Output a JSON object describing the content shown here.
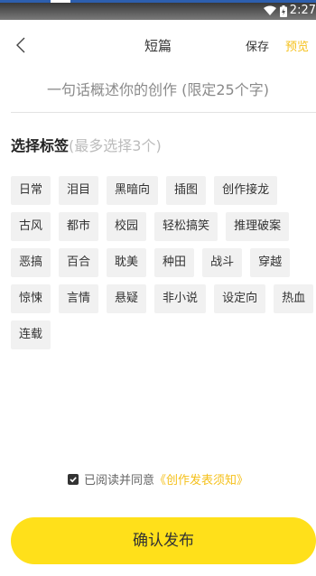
{
  "statusbar": {
    "time": "2:27"
  },
  "header": {
    "title": "短篇",
    "save_label": "保存",
    "preview_label": "预览"
  },
  "summary": {
    "placeholder": "一句话概述你的创作 (限定25个字)"
  },
  "tags_section": {
    "label": "选择标签",
    "hint": "(最多选择3个)"
  },
  "tags": [
    [
      "日常",
      "泪目",
      "黑暗向",
      "插图",
      "创作接龙"
    ],
    [
      "古风",
      "都市",
      "校园",
      "轻松搞笑",
      "推理破案"
    ],
    [
      "恶搞",
      "百合",
      "耽美",
      "种田",
      "战斗",
      "穿越"
    ],
    [
      "惊悚",
      "言情",
      "悬疑",
      "非小说",
      "设定向",
      "热血"
    ],
    [
      "连载"
    ]
  ],
  "agreement": {
    "text": "已阅读并同意",
    "link": "《创作发表须知》"
  },
  "publish_label": "确认发布",
  "colors": {
    "accent": "#f5c01a",
    "button": "#ffe01a",
    "tag_bg": "#f1f1f1"
  }
}
